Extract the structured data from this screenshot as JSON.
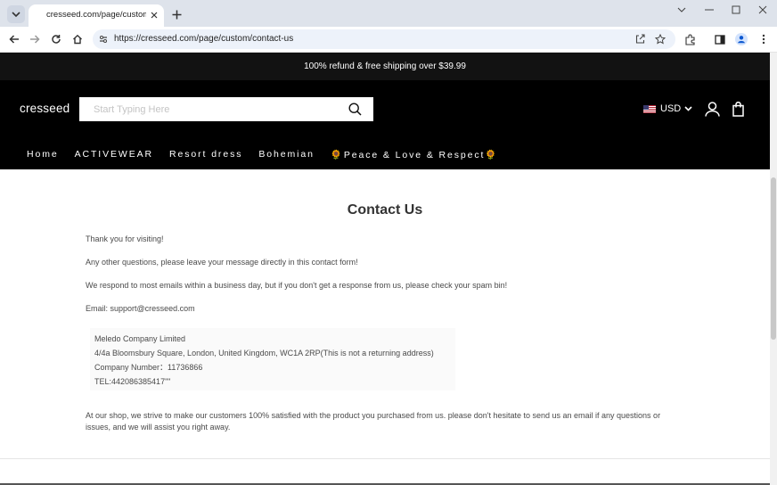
{
  "browser": {
    "tab_title": "cresseed.com/page/custom/contact-us",
    "url": "https://cresseed.com/page/custom/contact-us",
    "colors": {
      "tabstrip": "#dee3eb",
      "omnibox": "#edf2fa"
    }
  },
  "site": {
    "announcement": "100% refund & free shipping over $39.99",
    "logo": "cresseed",
    "search_placeholder": "Start Typing Here",
    "currency": "USD",
    "nav": [
      "Home",
      "ACTIVEWEAR",
      "Resort dress",
      "Bohemian",
      "🌻Peace & Love & Respect🌻"
    ],
    "colors": {
      "header": "#000000",
      "announcement": "#121212",
      "text": "#4a4a4a",
      "title": "#333333"
    }
  },
  "content": {
    "title": "Contact Us",
    "p1": "Thank you for visiting!",
    "p2": "Any other questions, please leave your message directly in this contact form!",
    "p3": "We respond to most emails within a business day, but if you don't get a response from us, please check your spam bin!",
    "email": "Email: support@cresseed.com",
    "address": {
      "company": "Meledo Company Limited",
      "street": "4/4a Bloomsbury Square, London, United Kingdom, WC1A 2RP(This is not a returning address)",
      "number": "Company Number：11736866",
      "tel": "TEL:442086385417\"\""
    },
    "closing": "At our shop, we strive to make our customers 100% satisfied with the product you purchased from us. please don't hesitate to send us an email if any questions or issues, and we will assist you right away."
  }
}
